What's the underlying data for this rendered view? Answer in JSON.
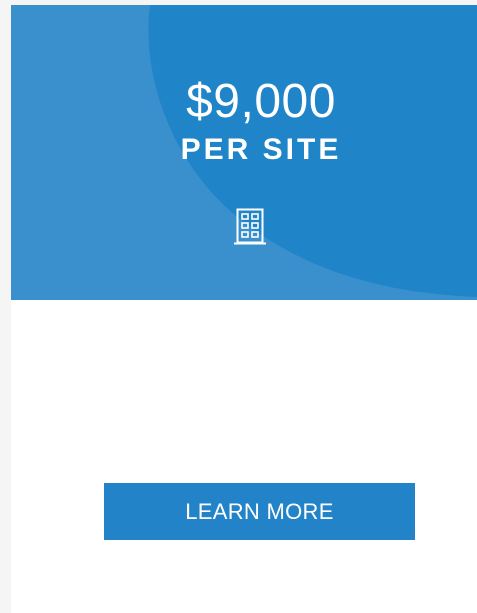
{
  "plan": {
    "price": "$9,000",
    "unit": "PER SITE",
    "icon": "building-icon",
    "button_label": "LEARN MORE"
  },
  "colors": {
    "hero_light": "#3a90cd",
    "hero_dark": "#1f84c8",
    "button": "#2383c8",
    "page_background": "#f5f5f5",
    "card_background": "#ffffff"
  }
}
